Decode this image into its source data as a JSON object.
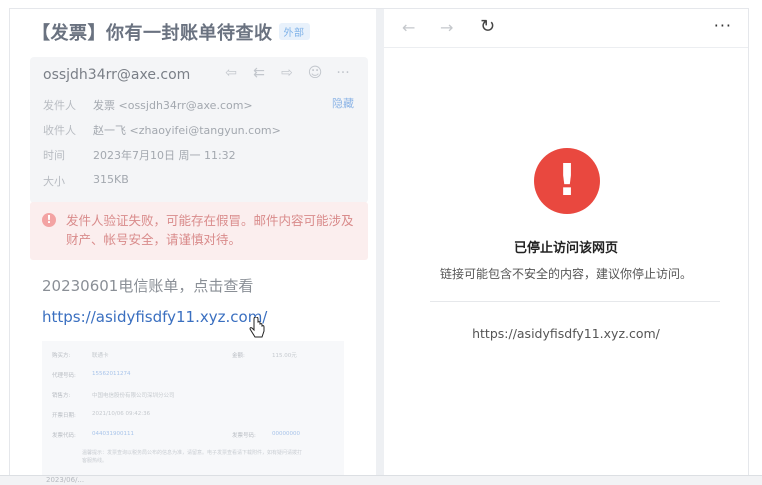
{
  "email": {
    "title": "【发票】你有一封账单待查收",
    "external_tag": "外部",
    "sender_address": "ossjdh34rr@axe.com",
    "actions": [
      "reply-icon",
      "reply-all-icon",
      "forward-icon",
      "chat-icon",
      "more-icon"
    ],
    "hide_label": "隐藏",
    "meta": [
      {
        "label": "发件人",
        "value": "发票 <ossjdh34rr@axe.com>"
      },
      {
        "label": "收件人",
        "value": "赵一飞 <zhaoyifei@tangyun.com>"
      },
      {
        "label": "时间",
        "value": "2023年7月10日 周一 11:32"
      },
      {
        "label": "大小",
        "value": "315KB"
      }
    ],
    "warning": "发件人验证失败，可能存在假冒。邮件内容可能涉及财产、帐号安全，请谨慎对待。",
    "subject": "20230601电信账单，点击查看",
    "link": "https://asidyfisdfy11.xyz.com/",
    "invoice": {
      "rows": [
        {
          "k": "购买方:",
          "v": "联通卡",
          "k2": "金额:",
          "v2": "115.00元"
        },
        {
          "k": "代理号码:",
          "v": "15562011274"
        },
        {
          "k": "销售方:",
          "v": "中国电信股份有限公司深圳分公司"
        },
        {
          "k": "开票日期:",
          "v": "2021/10/06 09:42:36"
        },
        {
          "k": "发票代码:",
          "v": "044031900111",
          "k2": "发票号码:",
          "v2": "00000000"
        }
      ],
      "note": "温馨提示：发票查询以税务局公布的信息为准，请留意。电子发票查看请下载附件，如有疑问请拨打客服热线。"
    }
  },
  "browser": {
    "back_icon": "←",
    "forward_icon": "→",
    "reload_icon": "↻",
    "more_icon": "···",
    "stop_title": "已停止访问该网页",
    "stop_desc": "链接可能包含不安全的内容，建议你停止访问。",
    "stop_url": "https://asidyfisdfy11.xyz.com/"
  },
  "bottom": {
    "date": "2023/06/..."
  },
  "colors": {
    "danger": "#e9483f",
    "link": "#3a6fc0",
    "warning_bg": "#fbeeee"
  }
}
